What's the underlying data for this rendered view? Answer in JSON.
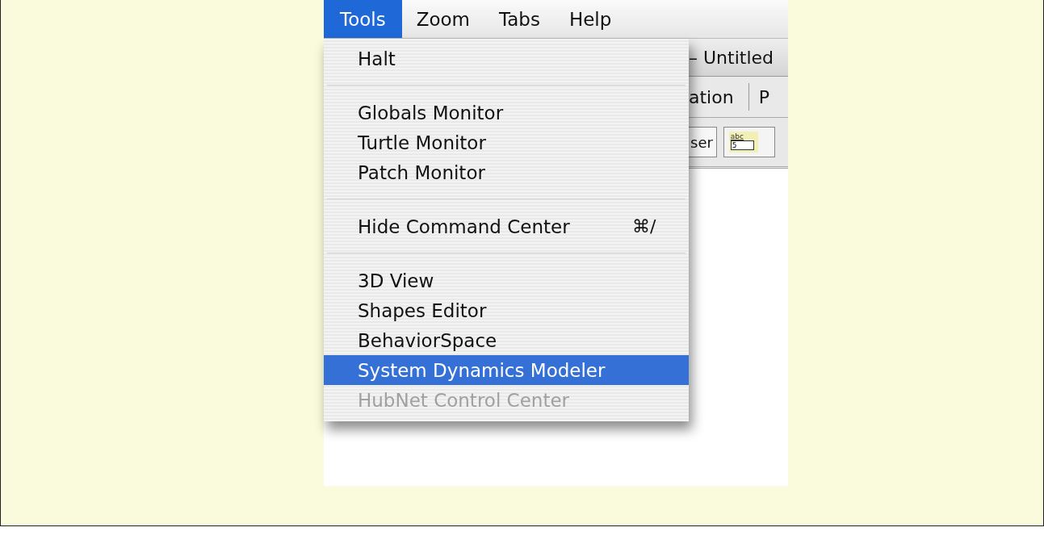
{
  "menu_bar": [
    {
      "label": "Tools",
      "selected": true
    },
    {
      "label": "Zoom",
      "selected": false
    },
    {
      "label": "Tabs",
      "selected": false
    },
    {
      "label": "Help",
      "selected": false
    }
  ],
  "menu": [
    {
      "kind": "item",
      "label": "Halt",
      "selected": false,
      "disabled": false
    },
    {
      "kind": "separator"
    },
    {
      "kind": "item",
      "label": "Globals Monitor",
      "selected": false,
      "disabled": false
    },
    {
      "kind": "item",
      "label": "Turtle Monitor",
      "selected": false,
      "disabled": false
    },
    {
      "kind": "item",
      "label": "Patch Monitor",
      "selected": false,
      "disabled": false
    },
    {
      "kind": "separator"
    },
    {
      "kind": "item",
      "label": "Hide Command Center",
      "shortcut": "⌘/",
      "selected": false,
      "disabled": false
    },
    {
      "kind": "separator"
    },
    {
      "kind": "item",
      "label": "3D View",
      "selected": false,
      "disabled": false
    },
    {
      "kind": "item",
      "label": "Shapes Editor",
      "selected": false,
      "disabled": false
    },
    {
      "kind": "item",
      "label": "BehaviorSpace",
      "selected": false,
      "disabled": false
    },
    {
      "kind": "item",
      "label": "System Dynamics Modeler",
      "selected": true,
      "disabled": false
    },
    {
      "kind": "item",
      "label": "HubNet Control Center",
      "selected": false,
      "disabled": true
    }
  ],
  "window": {
    "title": "– Untitled",
    "tabs": [
      "ation",
      "P"
    ],
    "toolbar": {
      "button": "ser",
      "input_widget": {
        "label": "abc",
        "value": "5"
      }
    }
  }
}
